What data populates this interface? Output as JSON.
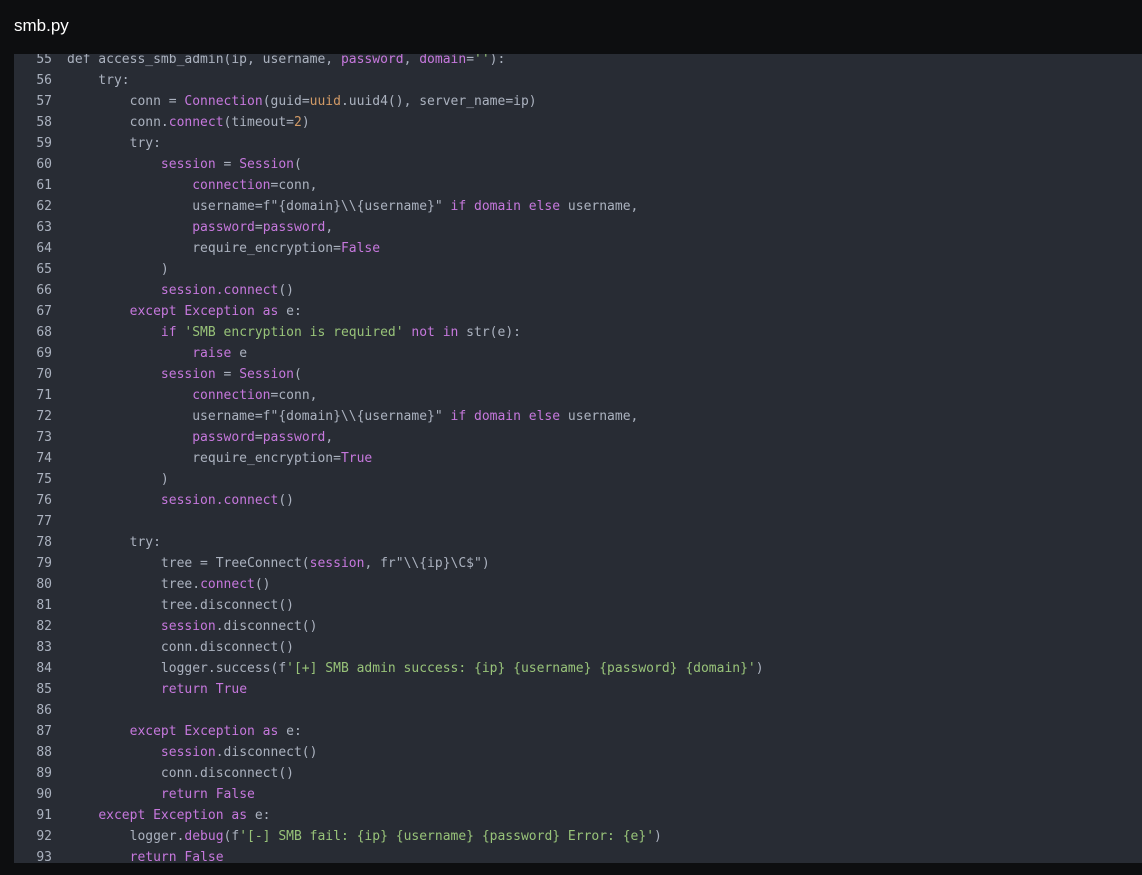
{
  "window": {
    "title": "smb.py"
  },
  "colors": {
    "background": "#0d0e10",
    "editor_background": "#282c34",
    "plain": "#abb2bf",
    "keyword": "#c678dd",
    "string": "#98c379",
    "number": "#d19a66"
  },
  "lines": [
    {
      "n": "55",
      "tokens": [
        [
          "p",
          "def access_smb_admin(ip, username, "
        ],
        [
          "k",
          "password"
        ],
        [
          "p",
          ", "
        ],
        [
          "k",
          "domain"
        ],
        [
          "p",
          "="
        ],
        [
          "s",
          "''"
        ],
        [
          "p",
          "):"
        ]
      ]
    },
    {
      "n": "56",
      "tokens": [
        [
          "p",
          "    try:"
        ]
      ]
    },
    {
      "n": "57",
      "tokens": [
        [
          "p",
          "        conn = "
        ],
        [
          "k",
          "Connection"
        ],
        [
          "p",
          "(guid="
        ],
        [
          "n",
          "uuid"
        ],
        [
          "p",
          ".uuid4(), server_name=ip)"
        ]
      ]
    },
    {
      "n": "58",
      "tokens": [
        [
          "p",
          "        conn."
        ],
        [
          "k",
          "connect"
        ],
        [
          "p",
          "(timeout="
        ],
        [
          "n",
          "2"
        ],
        [
          "p",
          ")"
        ]
      ]
    },
    {
      "n": "59",
      "tokens": [
        [
          "p",
          "        try:"
        ]
      ]
    },
    {
      "n": "60",
      "tokens": [
        [
          "p",
          "            "
        ],
        [
          "k",
          "session"
        ],
        [
          "p",
          " = "
        ],
        [
          "k",
          "Session"
        ],
        [
          "p",
          "("
        ]
      ]
    },
    {
      "n": "61",
      "tokens": [
        [
          "p",
          "                "
        ],
        [
          "k",
          "connection"
        ],
        [
          "p",
          "=conn,"
        ]
      ]
    },
    {
      "n": "62",
      "tokens": [
        [
          "p",
          "                username=f\"{domain}\\\\{username}\" "
        ],
        [
          "k",
          "if domain else"
        ],
        [
          "p",
          " username,"
        ]
      ]
    },
    {
      "n": "63",
      "tokens": [
        [
          "p",
          "                "
        ],
        [
          "k",
          "password"
        ],
        [
          "p",
          "="
        ],
        [
          "k",
          "password"
        ],
        [
          "p",
          ","
        ]
      ]
    },
    {
      "n": "64",
      "tokens": [
        [
          "p",
          "                require_encryption="
        ],
        [
          "k",
          "False"
        ]
      ]
    },
    {
      "n": "65",
      "tokens": [
        [
          "p",
          "            )"
        ]
      ]
    },
    {
      "n": "66",
      "tokens": [
        [
          "p",
          "            "
        ],
        [
          "k",
          "session.connect"
        ],
        [
          "p",
          "()"
        ]
      ]
    },
    {
      "n": "67",
      "tokens": [
        [
          "p",
          "        "
        ],
        [
          "k",
          "except Exception as"
        ],
        [
          "p",
          " e:"
        ]
      ]
    },
    {
      "n": "68",
      "tokens": [
        [
          "p",
          "            "
        ],
        [
          "k",
          "if"
        ],
        [
          "p",
          " "
        ],
        [
          "s",
          "'SMB encryption is required'"
        ],
        [
          "p",
          " "
        ],
        [
          "k",
          "not in"
        ],
        [
          "p",
          " str(e):"
        ]
      ]
    },
    {
      "n": "69",
      "tokens": [
        [
          "p",
          "                "
        ],
        [
          "k",
          "raise"
        ],
        [
          "p",
          " e"
        ]
      ]
    },
    {
      "n": "70",
      "tokens": [
        [
          "p",
          "            "
        ],
        [
          "k",
          "session"
        ],
        [
          "p",
          " = "
        ],
        [
          "k",
          "Session"
        ],
        [
          "p",
          "("
        ]
      ]
    },
    {
      "n": "71",
      "tokens": [
        [
          "p",
          "                "
        ],
        [
          "k",
          "connection"
        ],
        [
          "p",
          "=conn,"
        ]
      ]
    },
    {
      "n": "72",
      "tokens": [
        [
          "p",
          "                username=f\"{domain}\\\\{username}\" "
        ],
        [
          "k",
          "if domain else"
        ],
        [
          "p",
          " username,"
        ]
      ]
    },
    {
      "n": "73",
      "tokens": [
        [
          "p",
          "                "
        ],
        [
          "k",
          "password"
        ],
        [
          "p",
          "="
        ],
        [
          "k",
          "password"
        ],
        [
          "p",
          ","
        ]
      ]
    },
    {
      "n": "74",
      "tokens": [
        [
          "p",
          "                require_encryption="
        ],
        [
          "k",
          "True"
        ]
      ]
    },
    {
      "n": "75",
      "tokens": [
        [
          "p",
          "            )"
        ]
      ]
    },
    {
      "n": "76",
      "tokens": [
        [
          "p",
          "            "
        ],
        [
          "k",
          "session.connect"
        ],
        [
          "p",
          "()"
        ]
      ]
    },
    {
      "n": "77",
      "tokens": []
    },
    {
      "n": "78",
      "tokens": [
        [
          "p",
          "        try:"
        ]
      ]
    },
    {
      "n": "79",
      "tokens": [
        [
          "p",
          "            tree = TreeConnect("
        ],
        [
          "k",
          "session"
        ],
        [
          "p",
          ", fr\"\\\\{ip}\\C$\")"
        ]
      ]
    },
    {
      "n": "80",
      "tokens": [
        [
          "p",
          "            tree."
        ],
        [
          "k",
          "connect"
        ],
        [
          "p",
          "()"
        ]
      ]
    },
    {
      "n": "81",
      "tokens": [
        [
          "p",
          "            tree.disconnect()"
        ]
      ]
    },
    {
      "n": "82",
      "tokens": [
        [
          "p",
          "            "
        ],
        [
          "k",
          "session"
        ],
        [
          "p",
          ".disconnect()"
        ]
      ]
    },
    {
      "n": "83",
      "tokens": [
        [
          "p",
          "            conn.disconnect()"
        ]
      ]
    },
    {
      "n": "84",
      "tokens": [
        [
          "p",
          "            logger.success(f"
        ],
        [
          "s",
          "'[+] SMB admin success: {ip} {username} {password} {domain}'"
        ],
        [
          "p",
          ")"
        ]
      ]
    },
    {
      "n": "85",
      "tokens": [
        [
          "p",
          "            "
        ],
        [
          "k",
          "return True"
        ]
      ]
    },
    {
      "n": "86",
      "tokens": []
    },
    {
      "n": "87",
      "tokens": [
        [
          "p",
          "        "
        ],
        [
          "k",
          "except Exception as"
        ],
        [
          "p",
          " e:"
        ]
      ]
    },
    {
      "n": "88",
      "tokens": [
        [
          "p",
          "            "
        ],
        [
          "k",
          "session"
        ],
        [
          "p",
          ".disconnect()"
        ]
      ]
    },
    {
      "n": "89",
      "tokens": [
        [
          "p",
          "            conn.disconnect()"
        ]
      ]
    },
    {
      "n": "90",
      "tokens": [
        [
          "p",
          "            "
        ],
        [
          "k",
          "return False"
        ]
      ]
    },
    {
      "n": "91",
      "tokens": [
        [
          "p",
          "    "
        ],
        [
          "k",
          "except Exception as"
        ],
        [
          "p",
          " e:"
        ]
      ]
    },
    {
      "n": "92",
      "tokens": [
        [
          "p",
          "        logger."
        ],
        [
          "k",
          "debug"
        ],
        [
          "p",
          "(f"
        ],
        [
          "s",
          "'[-] SMB fail: {ip} {username} {password} Error: {e}'"
        ],
        [
          "p",
          ")"
        ]
      ]
    },
    {
      "n": "93",
      "tokens": [
        [
          "p",
          "        "
        ],
        [
          "k",
          "return False"
        ]
      ]
    }
  ]
}
